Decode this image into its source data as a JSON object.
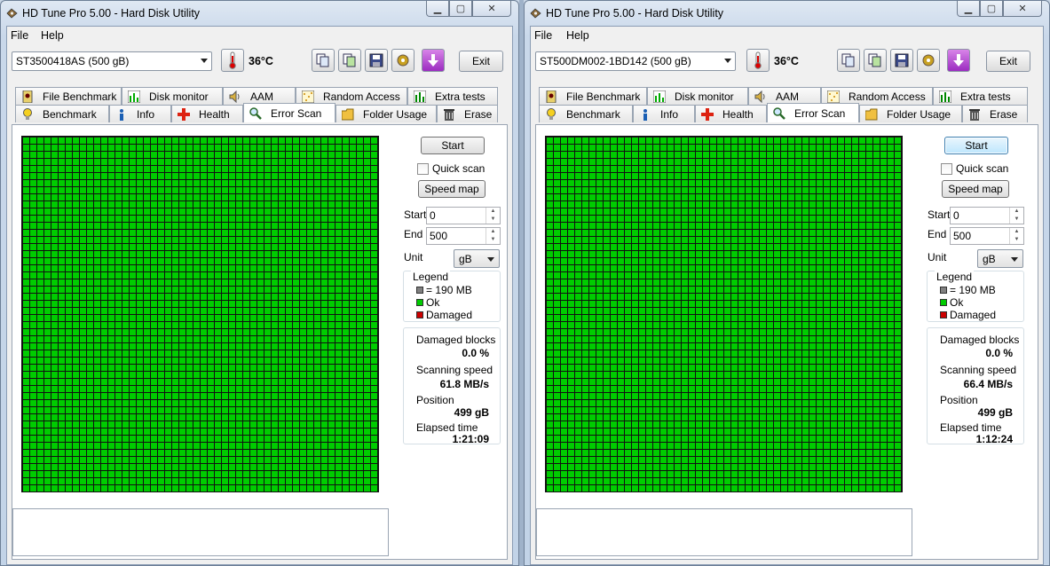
{
  "colors": {
    "ok_green": "#00cc00",
    "damaged_red": "#cc0000",
    "block_gray": "#808080"
  },
  "windows": [
    {
      "title": "HD Tune Pro 5.00 - Hard Disk Utility",
      "menu": {
        "file": "File",
        "help": "Help"
      },
      "drive": "ST3500418AS (500 gB)",
      "temperature": "36",
      "temperature_unit": "°C",
      "exit_label": "Exit",
      "tabs_top": [
        "File Benchmark",
        "Disk monitor",
        "AAM",
        "Random Access",
        "Extra tests"
      ],
      "tabs_bottom": [
        "Benchmark",
        "Info",
        "Health",
        "Error Scan",
        "Folder Usage",
        "Erase"
      ],
      "active_tab": "Error Scan",
      "start_label": "Start",
      "quick_scan_label": "Quick scan",
      "speed_map_label": "Speed map",
      "start_field_label": "Start",
      "start_value": "0",
      "end_field_label": "End",
      "end_value": "500",
      "unit_label": "Unit",
      "unit_value": "gB",
      "legend_title": "Legend",
      "legend_block": "= 190 MB",
      "legend_ok": "Ok",
      "legend_damaged": "Damaged",
      "damaged_label": "Damaged blocks",
      "damaged_value": "0.0 %",
      "speed_label": "Scanning speed",
      "speed_value": "61.8 MB/s",
      "position_label": "Position",
      "position_value": "499 gB",
      "elapsed_label": "Elapsed time",
      "elapsed_value": "1:21:09",
      "quick_scan_checked": false,
      "start_focused": false
    },
    {
      "title": "HD Tune Pro 5.00 - Hard Disk Utility",
      "menu": {
        "file": "File",
        "help": "Help"
      },
      "drive": "ST500DM002-1BD142 (500 gB)",
      "temperature": "36",
      "temperature_unit": "°C",
      "exit_label": "Exit",
      "tabs_top": [
        "File Benchmark",
        "Disk monitor",
        "AAM",
        "Random Access",
        "Extra tests"
      ],
      "tabs_bottom": [
        "Benchmark",
        "Info",
        "Health",
        "Error Scan",
        "Folder Usage",
        "Erase"
      ],
      "active_tab": "Error Scan",
      "start_label": "Start",
      "quick_scan_label": "Quick scan",
      "speed_map_label": "Speed map",
      "start_field_label": "Start",
      "start_value": "0",
      "end_field_label": "End",
      "end_value": "500",
      "unit_label": "Unit",
      "unit_value": "gB",
      "legend_title": "Legend",
      "legend_block": "= 190 MB",
      "legend_ok": "Ok",
      "legend_damaged": "Damaged",
      "damaged_label": "Damaged blocks",
      "damaged_value": "0.0 %",
      "speed_label": "Scanning speed",
      "speed_value": "66.4 MB/s",
      "position_label": "Position",
      "position_value": "499 gB",
      "elapsed_label": "Elapsed time",
      "elapsed_value": "1:12:24",
      "quick_scan_checked": false,
      "start_focused": true
    }
  ]
}
